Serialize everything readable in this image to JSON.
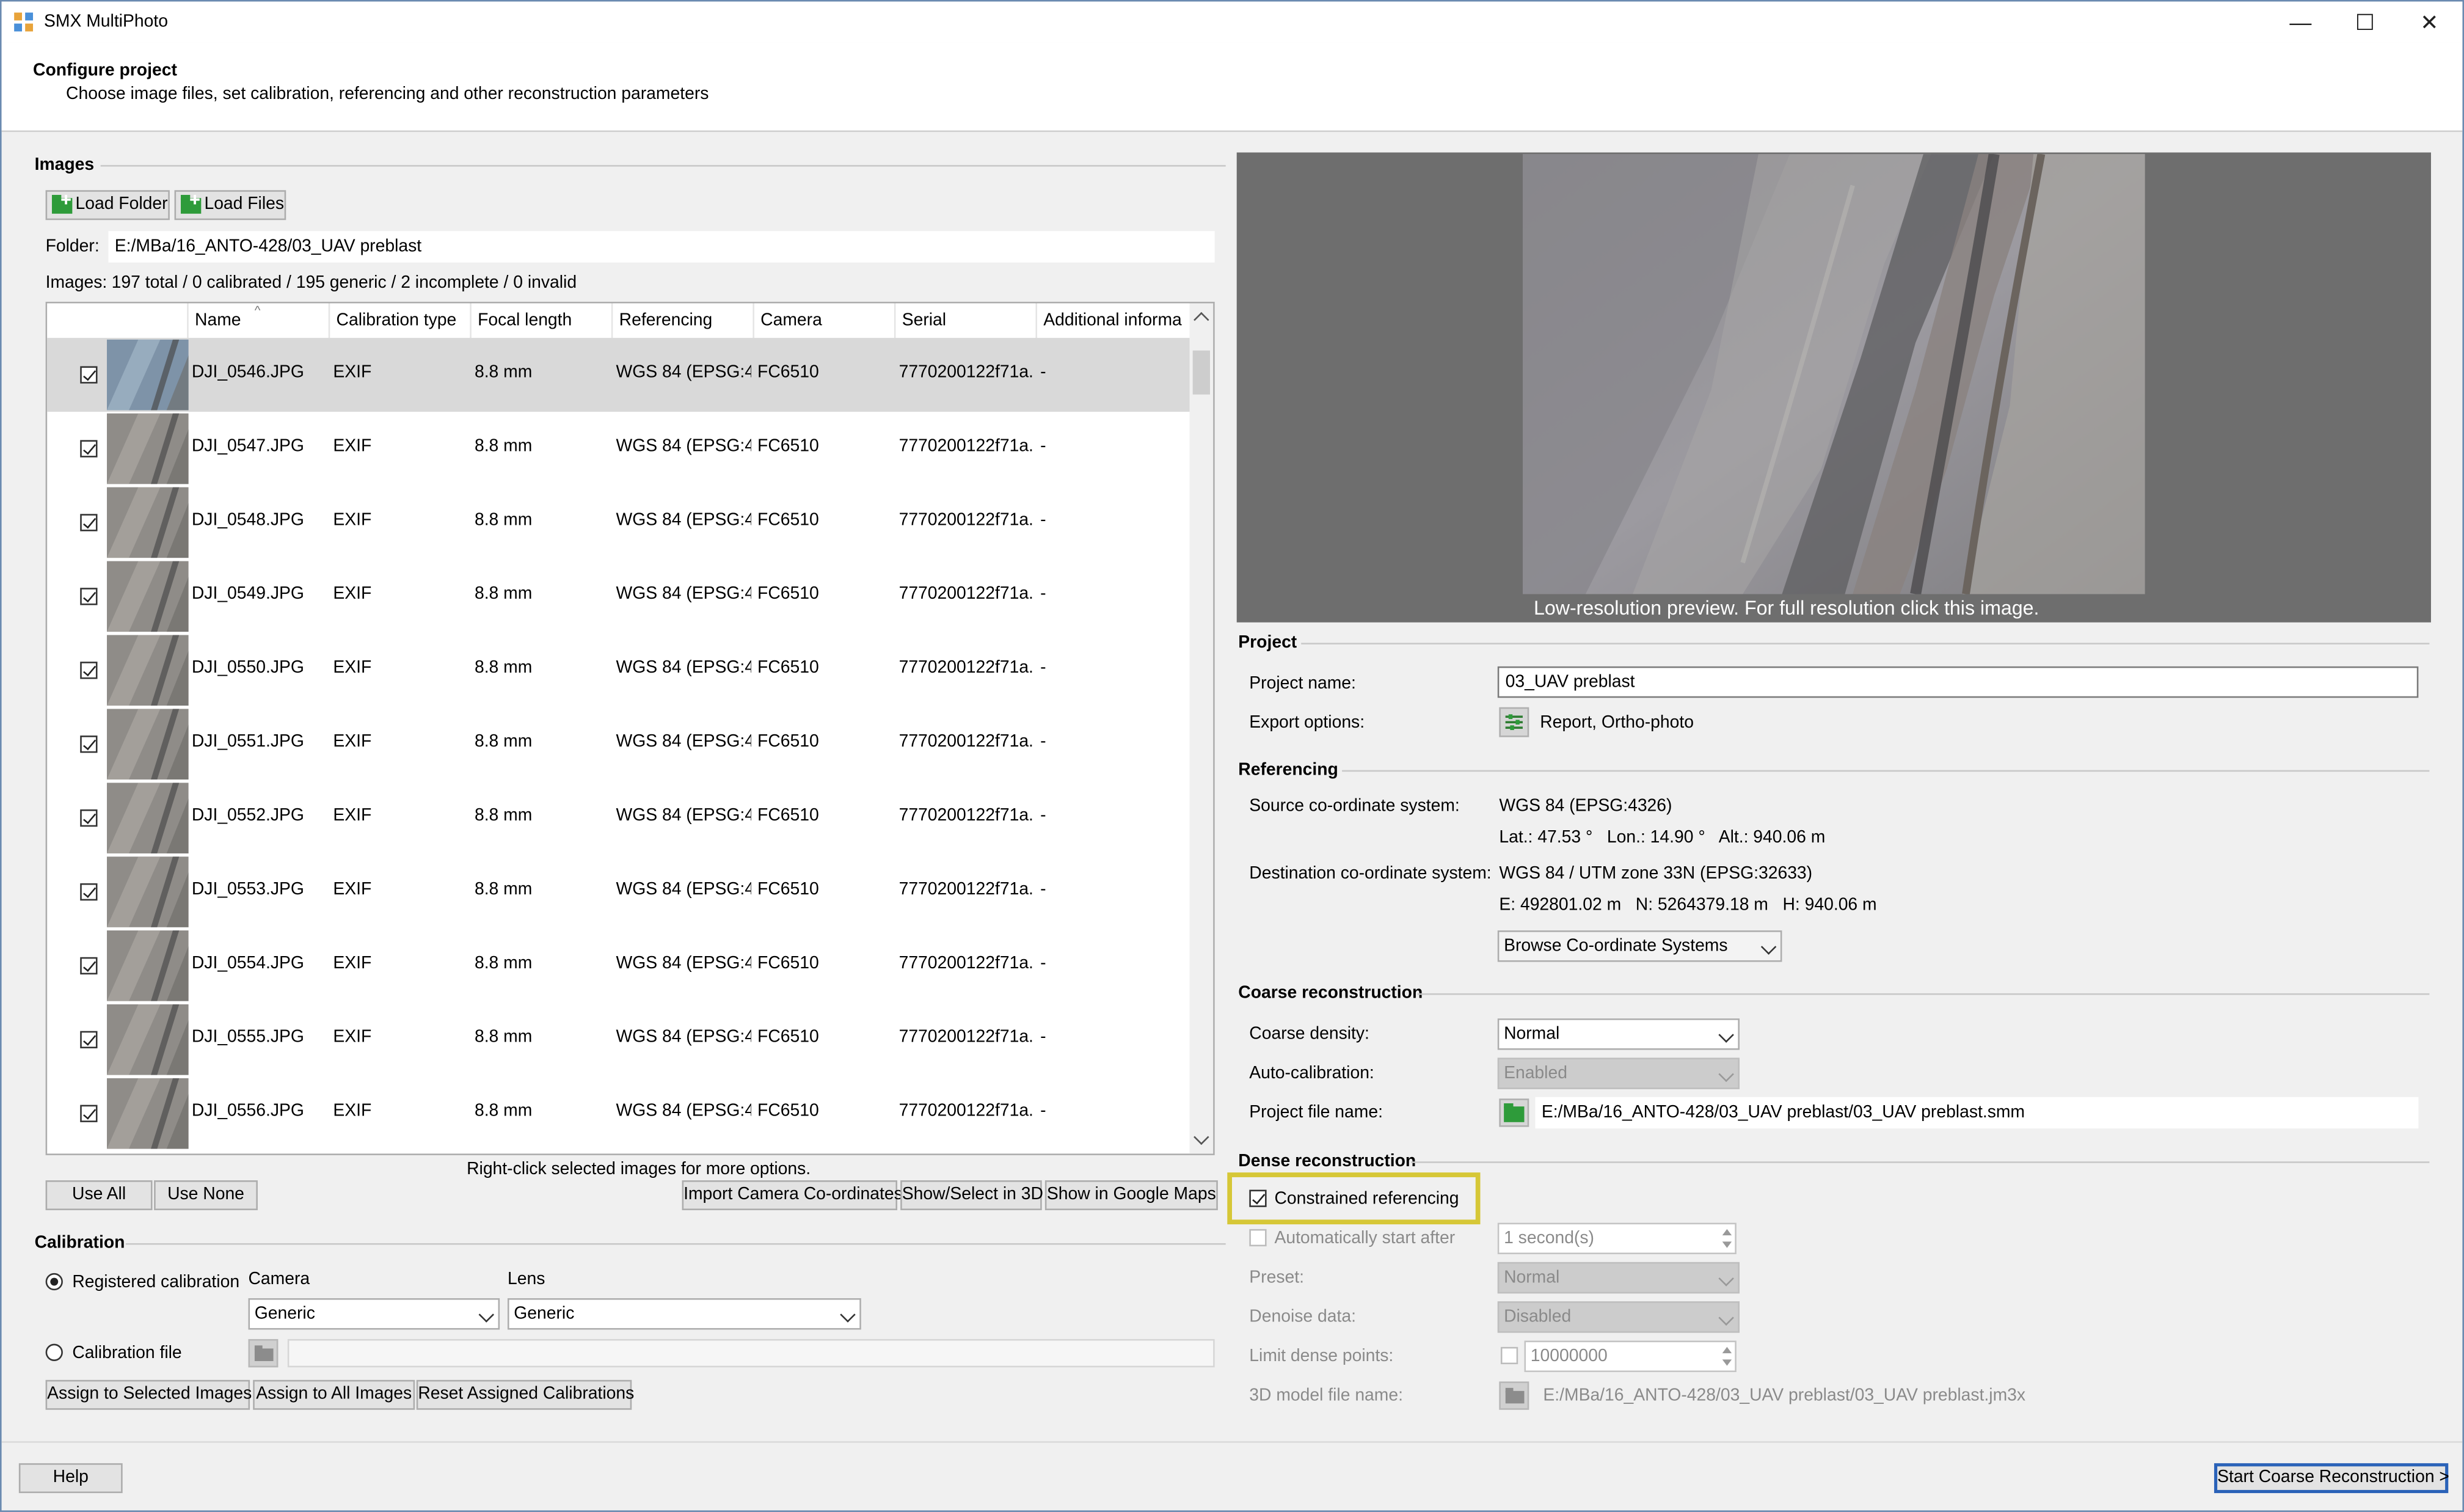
{
  "window": {
    "title": "SMX MultiPhoto",
    "minimize": "—",
    "maximize": "☐",
    "close": "✕"
  },
  "header": {
    "title": "Configure project",
    "subtitle": "Choose image files, set calibration, referencing and other reconstruction parameters"
  },
  "images": {
    "group_label": "Images",
    "load_folder": "Load Folder",
    "load_files": "Load Files",
    "folder_label": "Folder:",
    "folder_value": "E:/MBa/16_ANTO-428/03_UAV preblast",
    "summary_label": "Images:",
    "summary_value": "197 total / 0 calibrated / 195 generic / 2 incomplete / 0 invalid",
    "columns": [
      "Name",
      "Calibration type",
      "Focal length",
      "Referencing",
      "Camera",
      "Serial",
      "Additional informa"
    ],
    "rows": [
      {
        "name": "DJI_0546.JPG",
        "calib": "EXIF",
        "focal": "8.8 mm",
        "ref": "WGS 84 (EPSG:4...",
        "camera": "FC6510",
        "serial": "7770200122f71a...",
        "info": "-"
      },
      {
        "name": "DJI_0547.JPG",
        "calib": "EXIF",
        "focal": "8.8 mm",
        "ref": "WGS 84 (EPSG:4...",
        "camera": "FC6510",
        "serial": "7770200122f71a...",
        "info": "-"
      },
      {
        "name": "DJI_0548.JPG",
        "calib": "EXIF",
        "focal": "8.8 mm",
        "ref": "WGS 84 (EPSG:4...",
        "camera": "FC6510",
        "serial": "7770200122f71a...",
        "info": "-"
      },
      {
        "name": "DJI_0549.JPG",
        "calib": "EXIF",
        "focal": "8.8 mm",
        "ref": "WGS 84 (EPSG:4...",
        "camera": "FC6510",
        "serial": "7770200122f71a...",
        "info": "-"
      },
      {
        "name": "DJI_0550.JPG",
        "calib": "EXIF",
        "focal": "8.8 mm",
        "ref": "WGS 84 (EPSG:4...",
        "camera": "FC6510",
        "serial": "7770200122f71a...",
        "info": "-"
      },
      {
        "name": "DJI_0551.JPG",
        "calib": "EXIF",
        "focal": "8.8 mm",
        "ref": "WGS 84 (EPSG:4...",
        "camera": "FC6510",
        "serial": "7770200122f71a...",
        "info": "-"
      },
      {
        "name": "DJI_0552.JPG",
        "calib": "EXIF",
        "focal": "8.8 mm",
        "ref": "WGS 84 (EPSG:4...",
        "camera": "FC6510",
        "serial": "7770200122f71a...",
        "info": "-"
      },
      {
        "name": "DJI_0553.JPG",
        "calib": "EXIF",
        "focal": "8.8 mm",
        "ref": "WGS 84 (EPSG:4...",
        "camera": "FC6510",
        "serial": "7770200122f71a...",
        "info": "-"
      },
      {
        "name": "DJI_0554.JPG",
        "calib": "EXIF",
        "focal": "8.8 mm",
        "ref": "WGS 84 (EPSG:4...",
        "camera": "FC6510",
        "serial": "7770200122f71a...",
        "info": "-"
      },
      {
        "name": "DJI_0555.JPG",
        "calib": "EXIF",
        "focal": "8.8 mm",
        "ref": "WGS 84 (EPSG:4...",
        "camera": "FC6510",
        "serial": "7770200122f71a...",
        "info": "-"
      },
      {
        "name": "DJI_0556.JPG",
        "calib": "EXIF",
        "focal": "8.8 mm",
        "ref": "WGS 84 (EPSG:4...",
        "camera": "FC6510",
        "serial": "7770200122f71a...",
        "info": "-"
      }
    ],
    "use_all": "Use All",
    "use_none": "Use None",
    "hint": "Right-click selected images for more options.",
    "import_coords": "Import Camera Co-ordinates",
    "show_3d": "Show/Select in 3D",
    "show_google": "Show in Google Maps"
  },
  "calibration": {
    "group_label": "Calibration",
    "registered": "Registered calibration",
    "camera_label": "Camera",
    "lens_label": "Lens",
    "camera_value": "Generic",
    "lens_value": "Generic",
    "file": "Calibration file",
    "assign_selected": "Assign to Selected Images",
    "assign_all": "Assign to All Images",
    "reset": "Reset Assigned Calibrations"
  },
  "preview": {
    "caption": "Low-resolution preview. For full resolution click this image."
  },
  "project": {
    "group_label": "Project",
    "name_label": "Project name:",
    "name_value": "03_UAV preblast",
    "export_label": "Export options:",
    "export_value": "Report, Ortho-photo"
  },
  "referencing": {
    "group_label": "Referencing",
    "source_label": "Source co-ordinate system:",
    "source_value": "WGS 84 (EPSG:4326)",
    "source_coords": "Lat.: 47.53 °   Lon.: 14.90 °   Alt.: 940.06 m",
    "dest_label": "Destination co-ordinate system:",
    "dest_value": "WGS 84 / UTM zone 33N (EPSG:32633)",
    "dest_coords": "E: 492801.02 m   N: 5264379.18 m   H: 940.06 m",
    "browse": "Browse Co-ordinate Systems"
  },
  "coarse": {
    "group_label": "Coarse reconstruction",
    "density_label": "Coarse density:",
    "density_value": "Normal",
    "autocal_label": "Auto-calibration:",
    "autocal_value": "Enabled",
    "file_label": "Project file name:",
    "file_value": "E:/MBa/16_ANTO-428/03_UAV preblast/03_UAV preblast.smm"
  },
  "dense": {
    "group_label": "Dense reconstruction",
    "constrained": "Constrained referencing",
    "auto_start": "Automatically start after",
    "auto_value": "1 second(s)",
    "preset_label": "Preset:",
    "preset_value": "Normal",
    "denoise_label": "Denoise data:",
    "denoise_value": "Disabled",
    "limit_label": "Limit dense points:",
    "limit_value": "10000000",
    "model_label": "3D model file name:",
    "model_value": "E:/MBa/16_ANTO-428/03_UAV preblast/03_UAV preblast.jm3x"
  },
  "footer": {
    "help": "Help",
    "start": "Start Coarse Reconstruction >"
  }
}
